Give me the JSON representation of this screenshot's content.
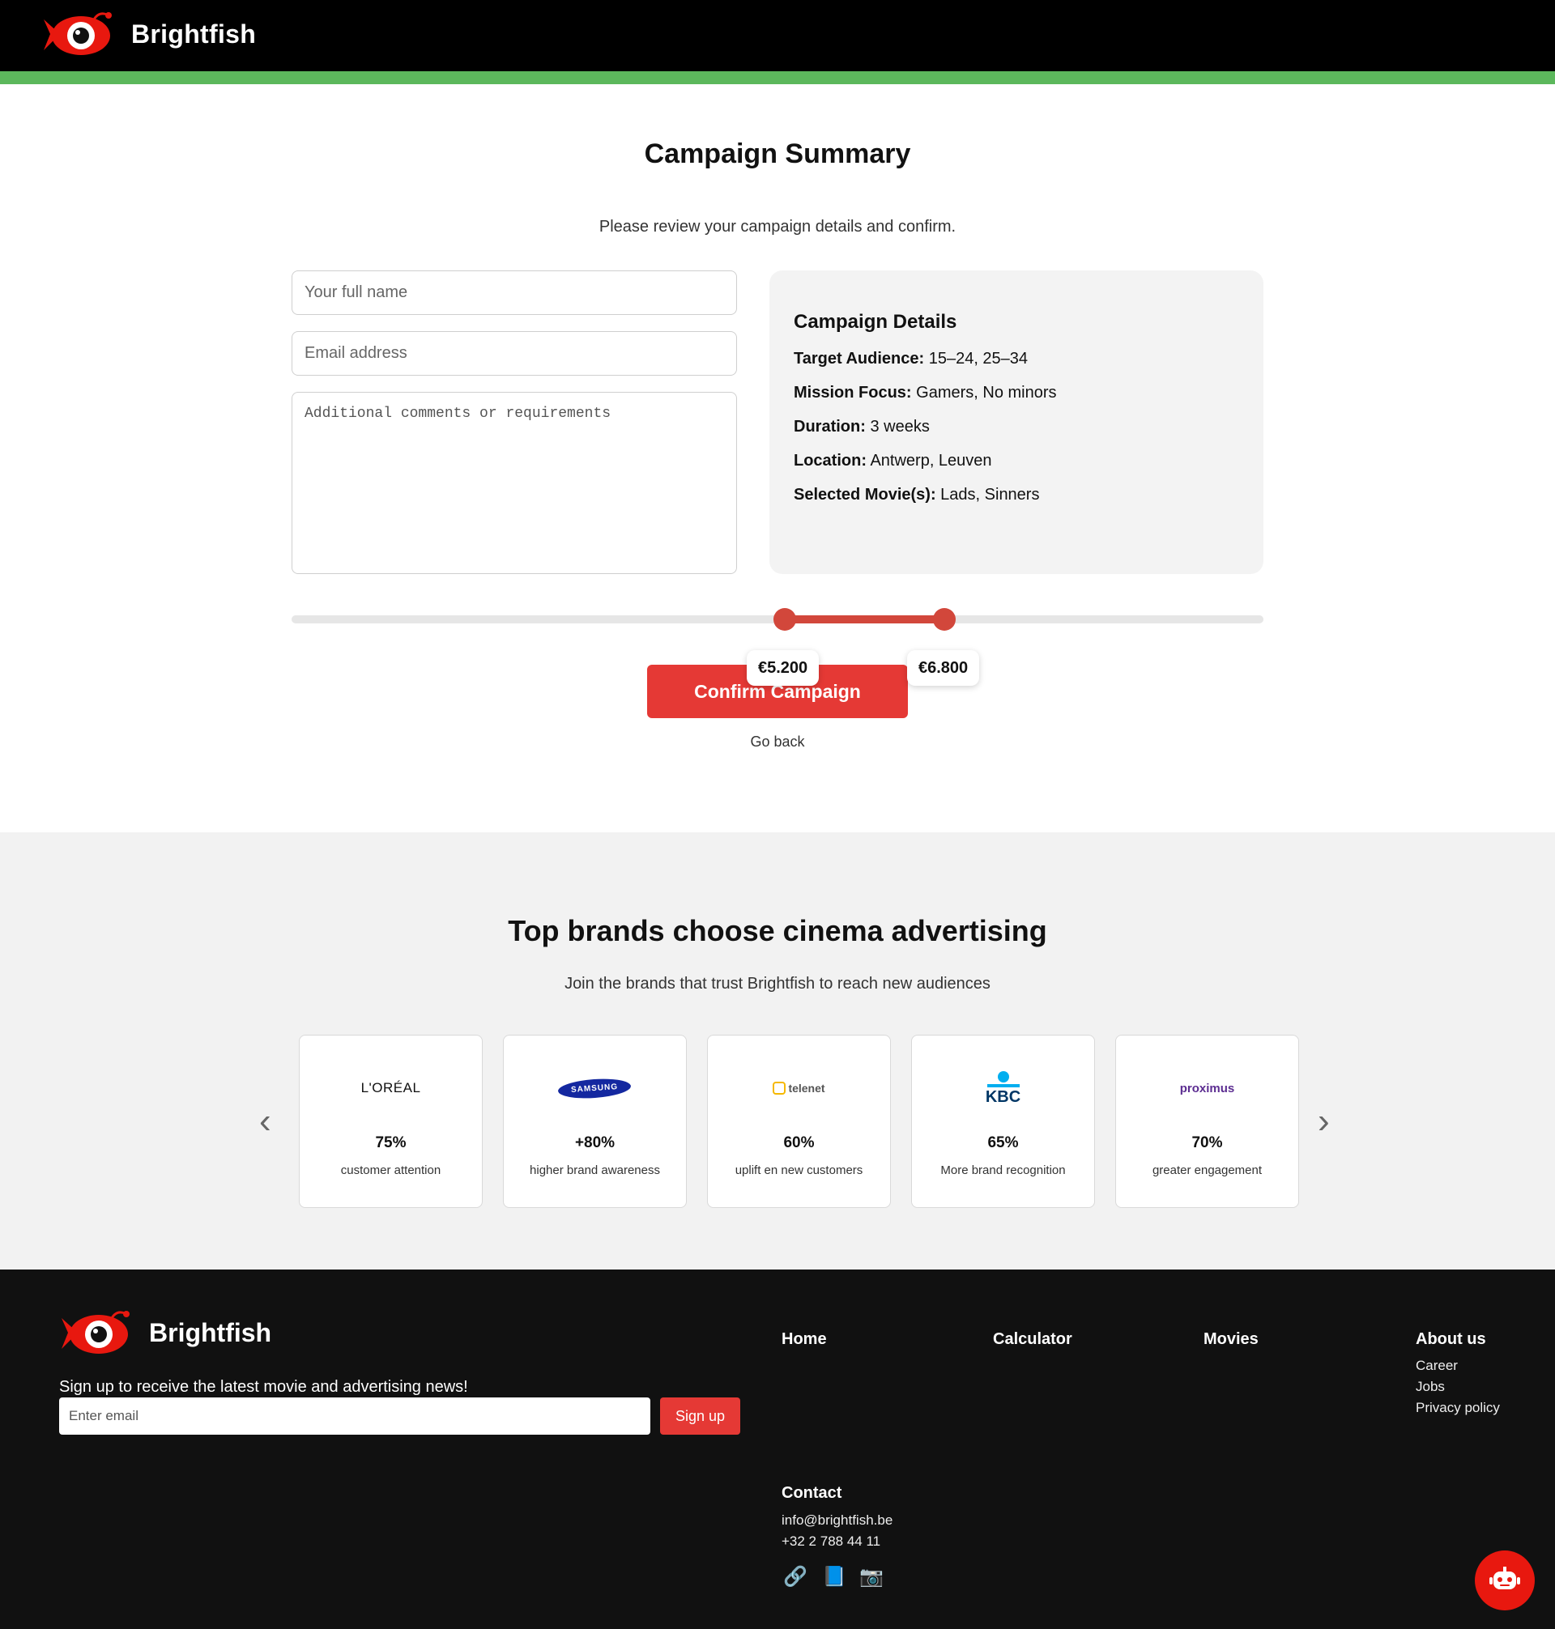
{
  "brand": {
    "name": "Brightfish"
  },
  "colors": {
    "accent": "#e53935",
    "green": "#5cb85c",
    "header": "#000000",
    "footer": "#111111"
  },
  "summary": {
    "title": "Campaign Summary",
    "subtitle": "Please review your campaign details and confirm.",
    "name_placeholder": "Your full name",
    "email_placeholder": "Email address",
    "comments_placeholder": "Additional comments or requirements"
  },
  "details": {
    "heading": "Campaign Details",
    "rows": [
      {
        "label": "Target Audience:",
        "value": "15–24, 25–34"
      },
      {
        "label": "Mission Focus:",
        "value": "Gamers, No minors"
      },
      {
        "label": "Duration:",
        "value": "3 weeks"
      },
      {
        "label": "Location:",
        "value": "Antwerp, Leuven"
      },
      {
        "label": "Selected Movie(s):",
        "value": "Lads, Sinners"
      }
    ]
  },
  "budget": {
    "min_label": "€5.200",
    "max_label": "€6.800"
  },
  "actions": {
    "confirm": "Confirm Campaign",
    "back": "Go back"
  },
  "brands": {
    "heading": "Top brands choose cinema advertising",
    "subheading": "Join the brands that trust Brightfish to reach new audiences",
    "prev_arrow": "‹",
    "next_arrow": "›",
    "cards": [
      {
        "logo": "L'ORÉAL",
        "stat": "75%",
        "label": "customer attention"
      },
      {
        "logo": "SAMSUNG",
        "stat": "+80%",
        "label": "higher brand awareness"
      },
      {
        "logo": "telenet",
        "stat": "60%",
        "label": "uplift en new customers"
      },
      {
        "logo": "KBC",
        "stat": "65%",
        "label": "More brand recognition"
      },
      {
        "logo": "proximus",
        "stat": "70%",
        "label": "greater engagement"
      }
    ]
  },
  "footer": {
    "tagline": "Sign up to receive the latest movie and advertising news!",
    "email_placeholder": "Enter email",
    "signup": "Sign up",
    "nav": {
      "home": "Home",
      "calculator": "Calculator",
      "movies": "Movies",
      "about": "About us"
    },
    "about_links": [
      "Career",
      "Jobs",
      "Privacy policy"
    ],
    "contact": {
      "heading": "Contact",
      "email": "info@brightfish.be",
      "phone": "+32 2 788 44 11"
    },
    "social_icons": [
      "link-icon",
      "book-icon",
      "camera-icon"
    ]
  }
}
